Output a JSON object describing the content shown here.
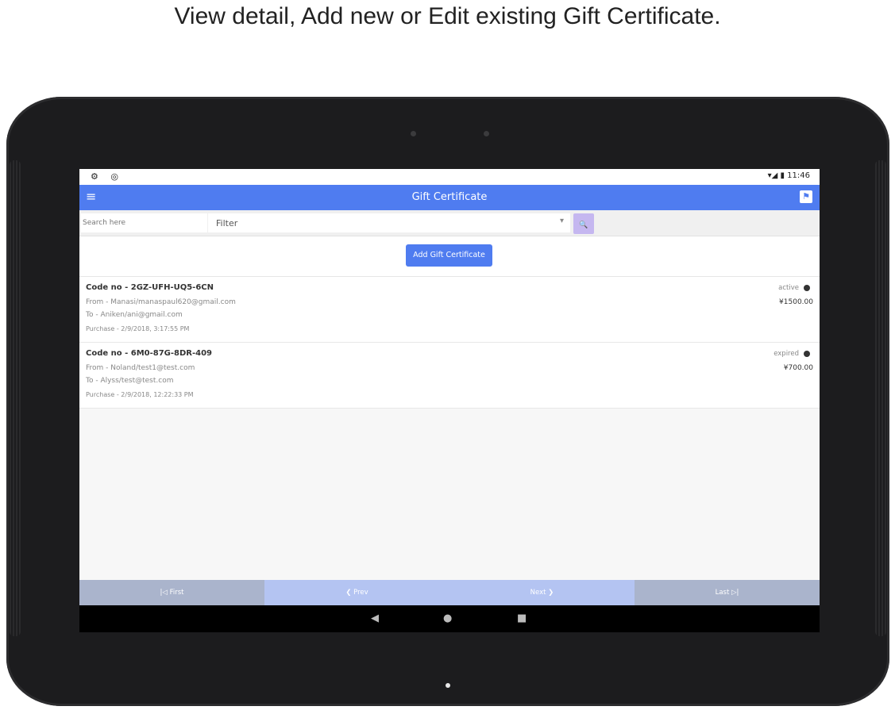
{
  "caption": "View detail, Add new or Edit existing Gift Certificate.",
  "status_bar": {
    "left_icons": "⚙ ◎",
    "right": "▾◢ ▮ 11:46"
  },
  "app_bar": {
    "title": "Gift Certificate",
    "menu_icon": "≡",
    "action_icon": "⚑"
  },
  "search": {
    "placeholder": "Search here",
    "filter_label": "Filter",
    "filter_caret": "▾",
    "search_icon": "🔍"
  },
  "add_button": "Add Gift Certificate",
  "certificates": [
    {
      "code": "Code no - 2GZ-UFH-UQ5-6CN",
      "from": "From - Manasi/manaspaul620@gmail.com",
      "to": "To - Aniken/ani@gmail.com",
      "purchase": "Purchase - 2/9/2018, 3:17:55 PM",
      "status": "active",
      "amount": "¥1500.00"
    },
    {
      "code": "Code no - 6M0-87G-8DR-409",
      "from": "From - Noland/test1@test.com",
      "to": "To - Alyss/test@test.com",
      "purchase": "Purchase - 2/9/2018, 12:22:33 PM",
      "status": "expired",
      "amount": "¥700.00"
    }
  ],
  "pager": {
    "first": "|◁ First",
    "prev": "❮ Prev",
    "next": "Next ❯",
    "last": "Last ▷|"
  },
  "nav": {
    "back": "◀",
    "home": "●",
    "recents": "■"
  },
  "colors": {
    "primary": "#4f7cf0",
    "pager_first_last": "#aab4cc",
    "pager_prev_next": "#b4c4f2",
    "search_button": "#c5b7f0"
  }
}
